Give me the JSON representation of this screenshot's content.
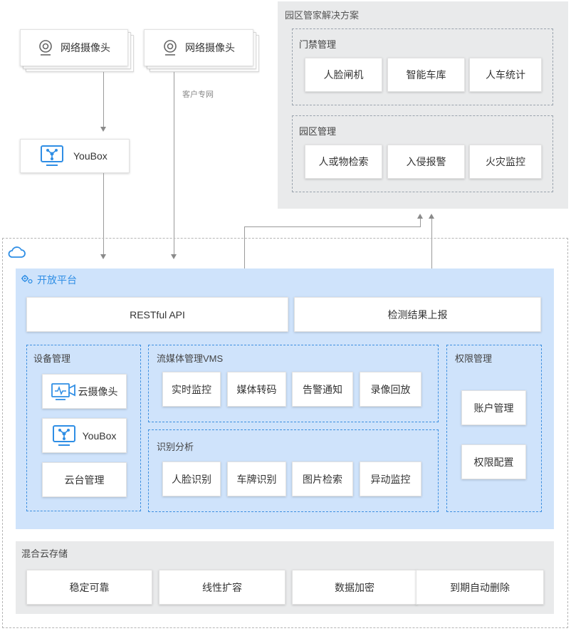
{
  "cameras": [
    {
      "label": "网络摄像头",
      "icon": "webcam-icon"
    },
    {
      "label": "网络摄像头",
      "icon": "webcam-icon"
    }
  ],
  "customer_network_label": "客户专网",
  "youbox_top": {
    "label": "YouBox",
    "icon": "youbox-icon"
  },
  "park_solution": {
    "title": "园区管家解决方案",
    "access_control": {
      "title": "门禁管理",
      "items": [
        "人脸闸机",
        "智能车库",
        "人车统计"
      ]
    },
    "park_management": {
      "title": "园区管理",
      "items": [
        "人或物检索",
        "入侵报警",
        "火灾监控"
      ]
    }
  },
  "cloud": {
    "icon": "cloud-icon",
    "open_platform": {
      "title": "开放平台",
      "icon": "gear-icon",
      "restful_api": "RESTful API",
      "detection_report": "检测结果上报",
      "device_management": {
        "title": "设备管理",
        "items": [
          {
            "label": "云摄像头",
            "icon": "cloud-camera-icon"
          },
          {
            "label": "YouBox",
            "icon": "youbox-icon"
          },
          {
            "label": "云台管理",
            "icon": ""
          }
        ]
      },
      "vms": {
        "title": "流媒体管理VMS",
        "items": [
          "实时监控",
          "媒体转码",
          "告警通知",
          "录像回放"
        ]
      },
      "recognition": {
        "title": "识别分析",
        "items": [
          "人脸识别",
          "车牌识别",
          "图片检索",
          "异动监控"
        ]
      },
      "permissions": {
        "title": "权限管理",
        "items": [
          "账户管理",
          "权限配置"
        ]
      }
    },
    "storage": {
      "title": "混合云存储",
      "items": [
        "稳定可靠",
        "线性扩容",
        "数据加密",
        "到期自动删除"
      ]
    }
  },
  "colors": {
    "platform_bg": "#cfe3fb",
    "gray_panel": "#e9eaeb",
    "accent_blue": "#2f8ee5",
    "line_gray": "#9a9a9a"
  }
}
